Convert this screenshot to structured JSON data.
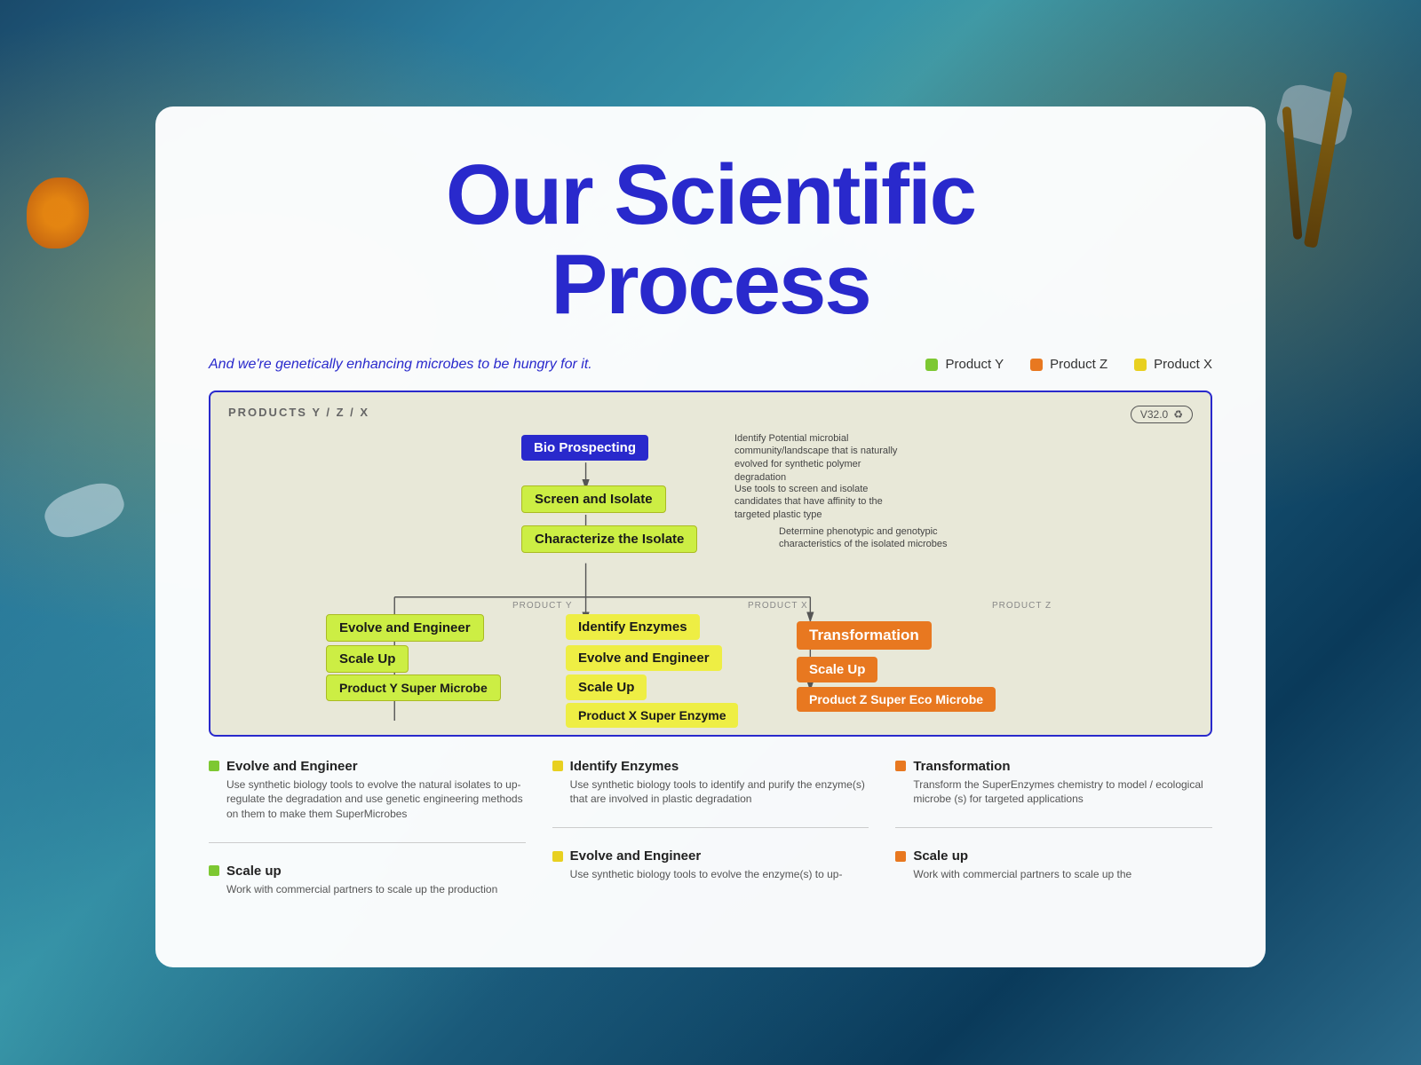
{
  "background": {
    "color": "#1a4a6b"
  },
  "card": {
    "title_line1": "Our Scientific",
    "title_line2": "Process",
    "subtitle": "And we're genetically enhancing microbes to be hungry for it.",
    "products": [
      {
        "label": "Product Y",
        "color": "green",
        "dot": "green"
      },
      {
        "label": "Product Z",
        "color": "orange",
        "dot": "orange"
      },
      {
        "label": "Product X",
        "color": "yellow",
        "dot": "yellow"
      }
    ]
  },
  "diagram": {
    "header_label": "PRODUCTS  Y / Z / X",
    "version": "V32.0",
    "nodes": {
      "bio_prospecting": "Bio Prospecting",
      "bio_desc": "Identify Potential microbial community/landscape that is naturally evolved for synthetic polymer degradation",
      "screen_isolate": "Screen and Isolate",
      "screen_desc": "Use tools to screen and isolate candidates that have affinity to the targeted plastic type",
      "characterize": "Characterize the Isolate",
      "char_desc": "Determine phenotypic and genotypic characteristics of the isolated microbes",
      "identify_enzymes": "Identify Enzymes",
      "evolve_engineer": "Evolve and Engineer",
      "scale_up_x": "Scale Up",
      "product_x": "Product X Super Enzyme",
      "product_x_label": "PRODUCT X",
      "evolve_engineer_y": "Evolve and Engineer",
      "scale_up_y": "Scale Up",
      "product_y": "Product Y Super Microbe",
      "product_y_label": "PRODUCT Y",
      "transformation": "Transformation",
      "scale_up_z": "Scale Up",
      "product_z": "Product Z Super Eco Microbe",
      "product_z_label": "PRODUCT Z"
    }
  },
  "bottom_info": {
    "columns": [
      {
        "dot_color": "#7dc832",
        "items": [
          {
            "title": "Evolve and Engineer",
            "description": "Use synthetic biology tools to evolve the natural isolates to up-regulate the degradation and use genetic engineering methods on them to make them SuperMicrobes"
          },
          {
            "title": "Scale up",
            "description": "Work with commercial partners to scale up the production"
          }
        ]
      },
      {
        "dot_color": "#eeee00",
        "items": [
          {
            "title": "Identify Enzymes",
            "description": "Use synthetic biology tools to identify and purify the enzyme(s) that are involved in plastic degradation"
          },
          {
            "title": "Evolve and Engineer",
            "description": "Use synthetic biology tools to evolve the enzyme(s) to up-"
          }
        ]
      },
      {
        "dot_color": "#e87820",
        "items": [
          {
            "title": "Transformation",
            "description": "Transform the SuperEnzymes chemistry to model / ecological microbe (s) for targeted applications"
          },
          {
            "title": "Scale up",
            "description": "Work with commercial partners to scale up the"
          }
        ]
      }
    ]
  }
}
